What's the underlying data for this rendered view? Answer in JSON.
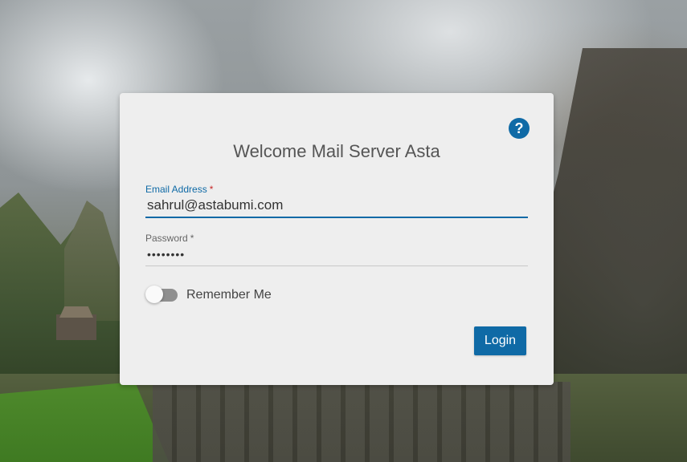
{
  "background": {
    "scene": "mountain-ruins-with-clouds"
  },
  "login": {
    "title": "Welcome Mail Server Asta",
    "help_icon_glyph": "?",
    "email": {
      "label": "Email Address",
      "required_mark": "*",
      "value": "sahrul@astabumi.com"
    },
    "password": {
      "label": "Password",
      "required_mark": "*",
      "masked_value": "••••••••"
    },
    "remember": {
      "label": "Remember Me",
      "checked": false
    },
    "submit_label": "Login"
  },
  "colors": {
    "accent": "#0f6aa6",
    "card_bg": "#eeeeee",
    "required": "#c62828"
  }
}
